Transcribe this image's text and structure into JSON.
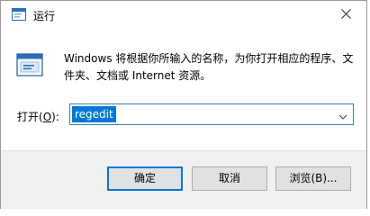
{
  "window": {
    "title": "运行",
    "title_icon": "run-dialog-icon",
    "close_icon": "close-icon"
  },
  "main": {
    "icon": "run-icon",
    "description": "Windows 将根据你所输入的名称，为你打开相应的程序、文件夹、文档或 Internet 资源。",
    "open_label_prefix": "打开(",
    "open_label_accel": "O",
    "open_label_suffix": "):",
    "input_value": "regedit",
    "dropdown_icon": "chevron-down-icon"
  },
  "buttons": {
    "ok": "确定",
    "cancel": "取消",
    "browse": "浏览(B)..."
  },
  "colors": {
    "accent": "#0078d7",
    "footer_bg": "#f0f0f0",
    "button_bg": "#e1e1e1"
  }
}
